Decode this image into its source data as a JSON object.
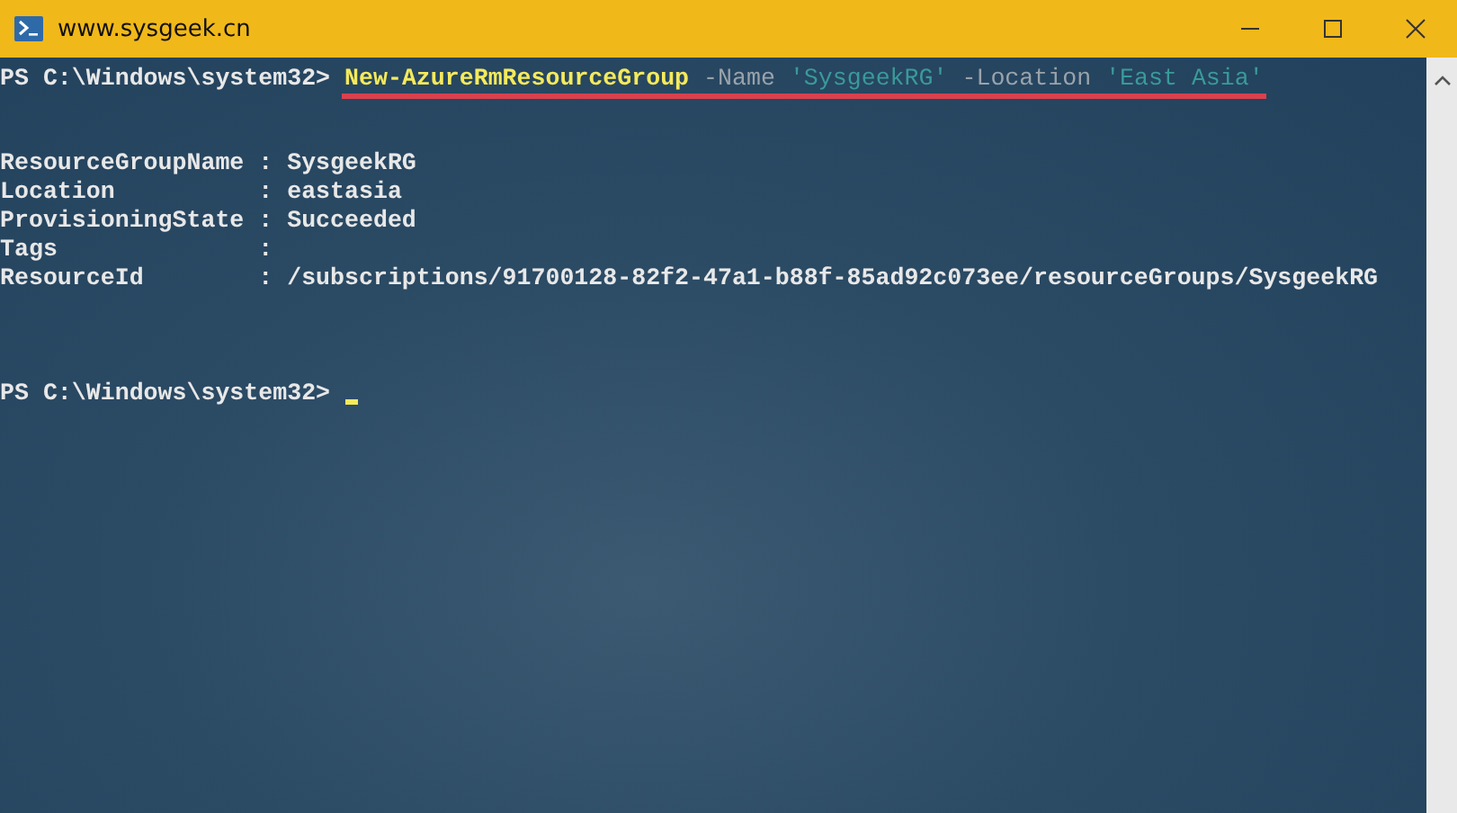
{
  "window": {
    "title": "www.sysgeek.cn"
  },
  "console": {
    "command_line": {
      "prompt": "PS C:\\Windows\\system32>",
      "underlined": true,
      "tokens": [
        {
          "kind": "command",
          "text": "New-AzureRmResourceGroup"
        },
        {
          "kind": "parameter",
          "text": "-Name"
        },
        {
          "kind": "string",
          "text": "'SysgeekRG'"
        },
        {
          "kind": "parameter",
          "text": "-Location"
        },
        {
          "kind": "string",
          "text": "'East Asia'"
        }
      ]
    },
    "output_lines": [
      "ResourceGroupName : SysgeekRG",
      "Location          : eastasia",
      "ProvisioningState : Succeeded",
      "Tags              :",
      "ResourceId        : /subscriptions/91700128-82f2-47a1-b88f-85ad92c073ee/resourceGroups/SysgeekRG"
    ],
    "final_prompt": "PS C:\\Windows\\system32>"
  }
}
